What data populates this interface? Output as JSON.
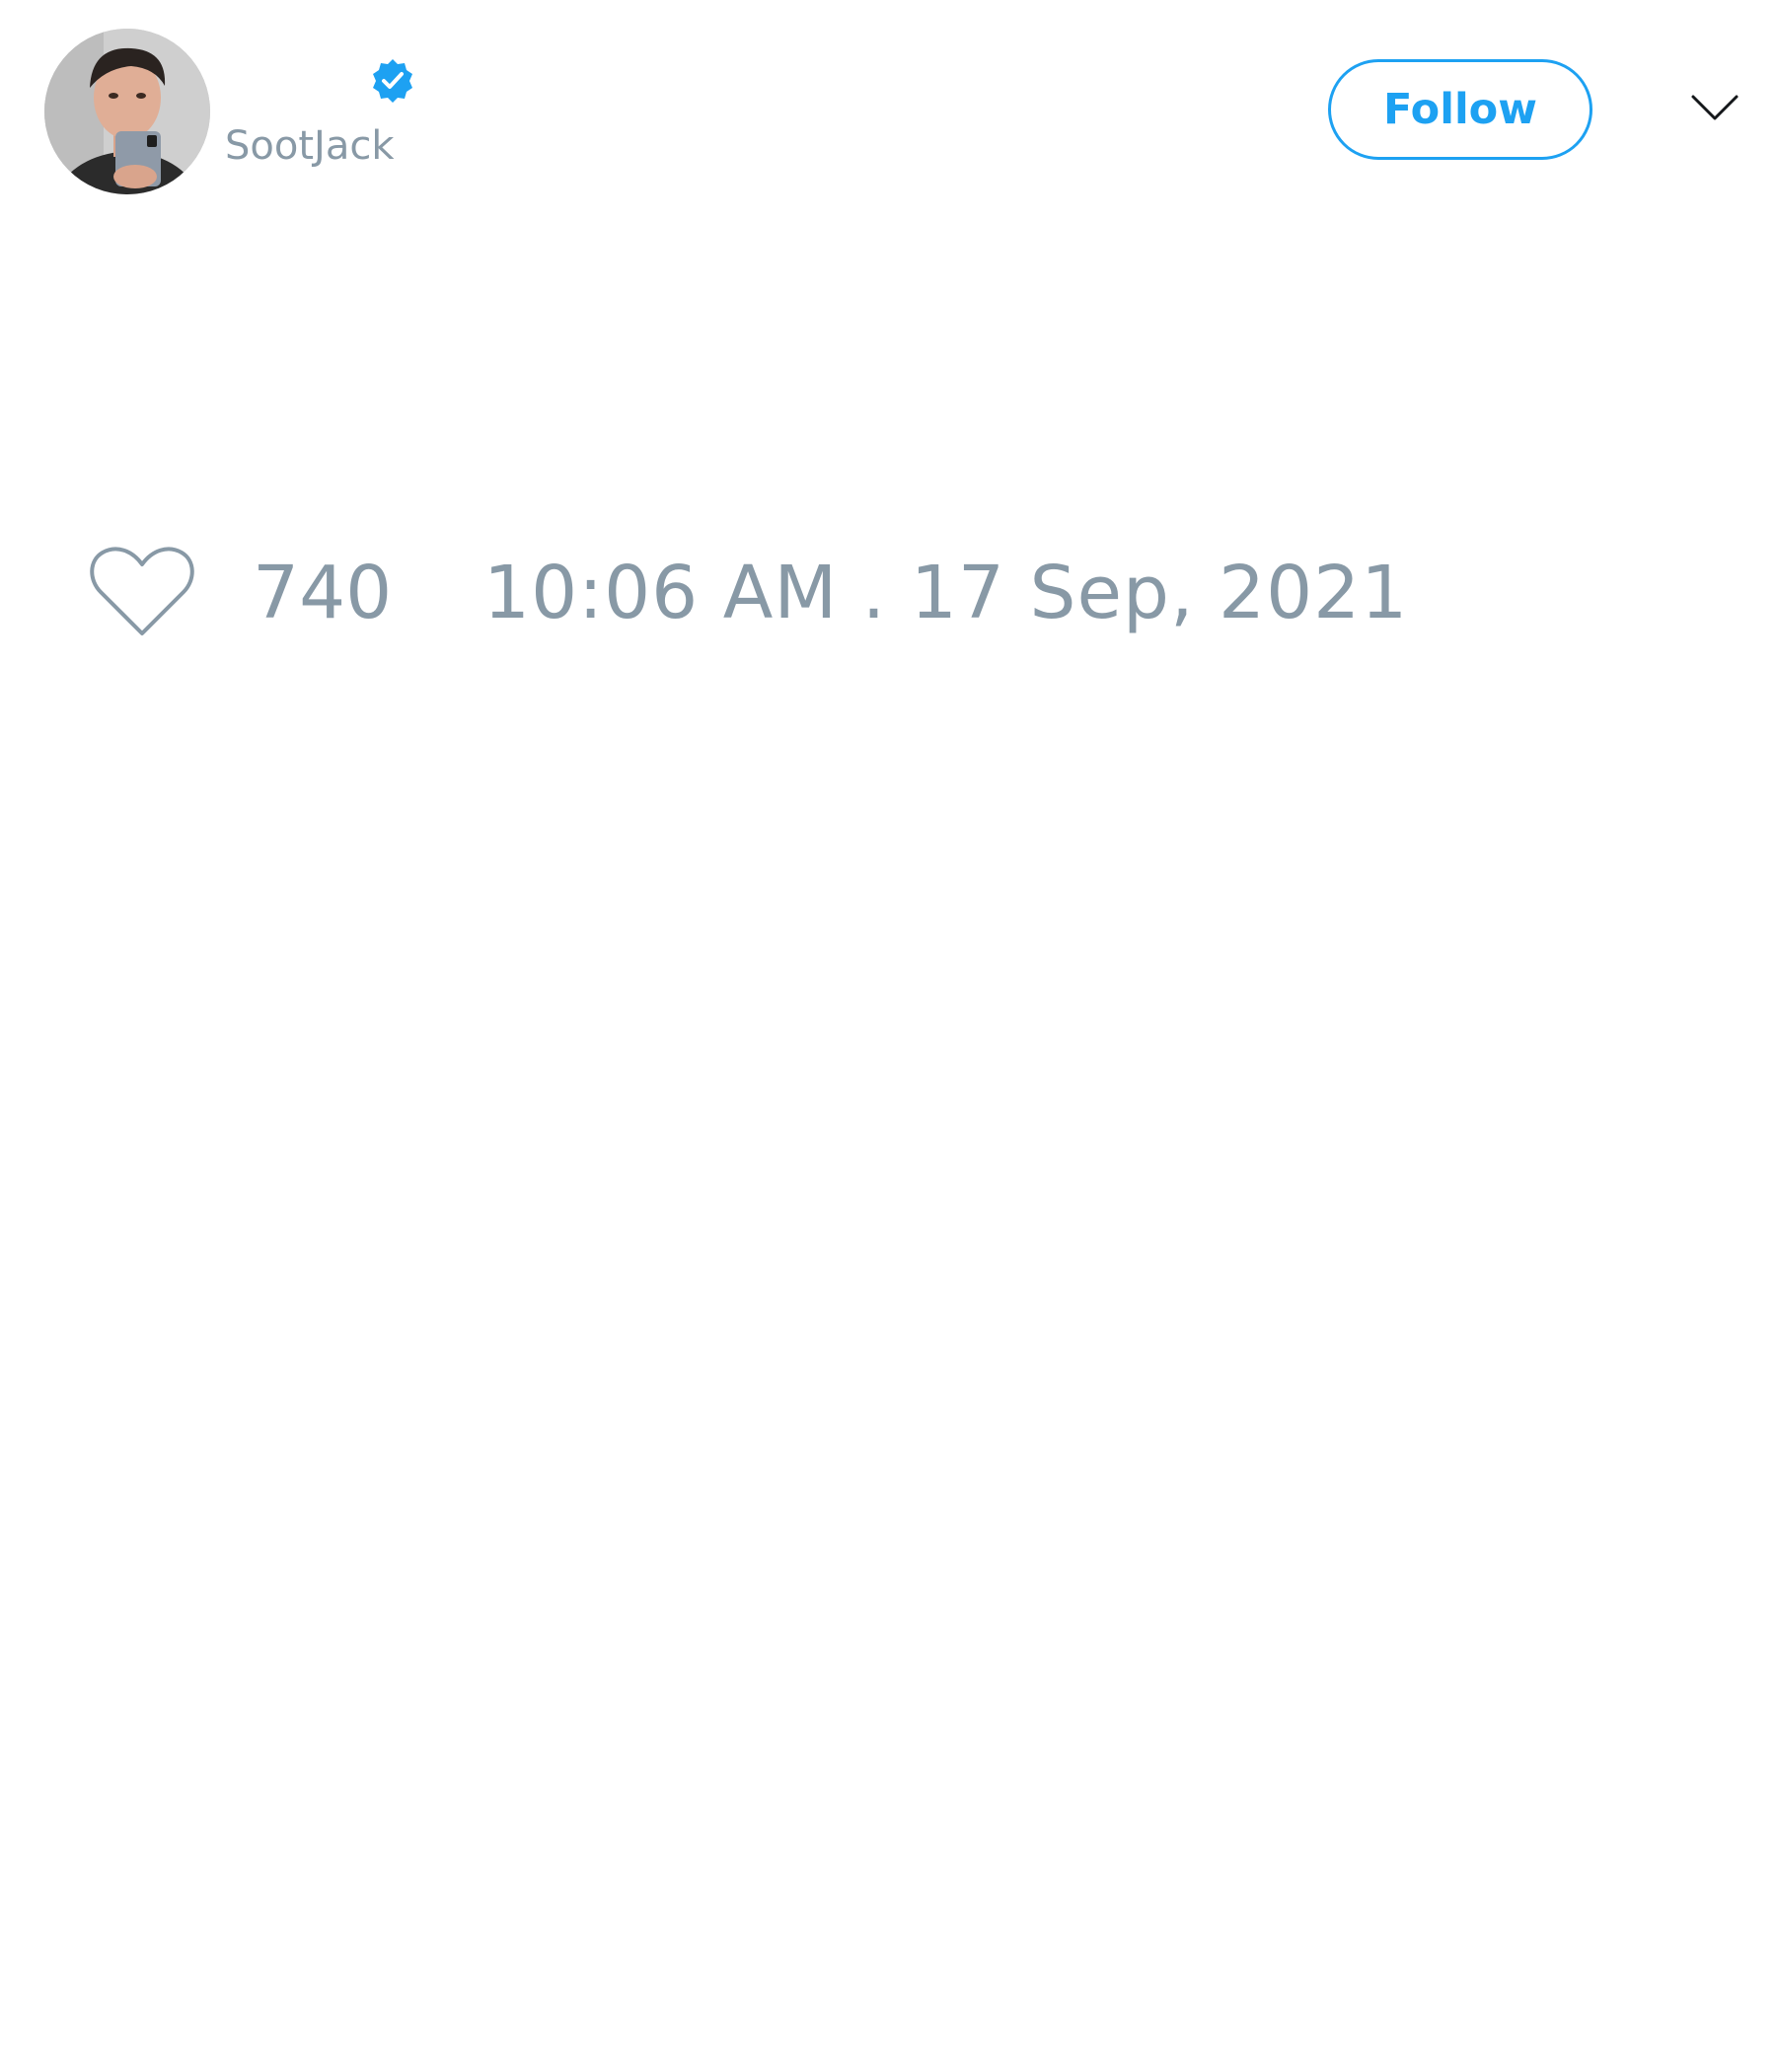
{
  "tweet": {
    "author": {
      "handle": "SootJack",
      "verified": true,
      "verified_icon": "verified-badge-icon",
      "avatar_icon": "profile-photo"
    },
    "follow_label": "Follow",
    "menu_icon": "chevron-down-icon",
    "like_icon": "heart-outline-icon",
    "like_count": "740",
    "timestamp": "10:06 AM . 17 Sep, 2021"
  },
  "colors": {
    "accent": "#1da1f2",
    "muted_text": "#8899a6",
    "background": "#ffffff"
  }
}
